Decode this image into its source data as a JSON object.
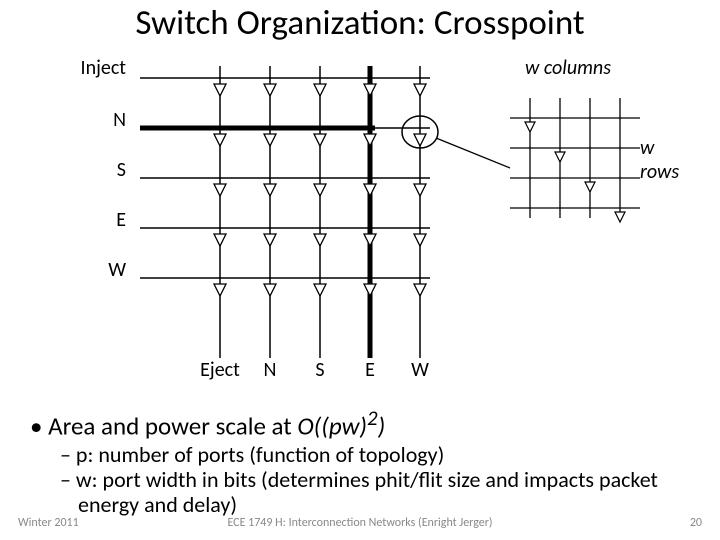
{
  "title": "Switch Organization: Crosspoint",
  "rows": [
    "Inject",
    "N",
    "S",
    "E",
    "W"
  ],
  "cols": [
    "Eject",
    "N",
    "S",
    "E",
    "W"
  ],
  "w_columns_label": "w columns",
  "w_rows_label": "w rows",
  "bullet_main_prefix": "• Area and power scale at ",
  "bullet_main_formula": "O((pw)",
  "bullet_main_exp": "2",
  "bullet_main_suffix": ")",
  "sub1": "– p: number of ports (function of topology)",
  "sub2": "– w: port width in bits (determines phit/flit size and impacts packet energy and delay)",
  "footer_left": "Winter 2011",
  "footer_center": "ECE 1749 H: Interconnection Networks (Enright Jerger)",
  "footer_right": "20"
}
